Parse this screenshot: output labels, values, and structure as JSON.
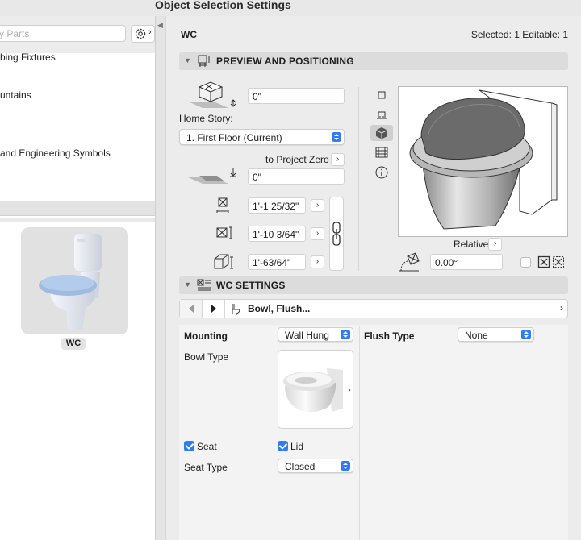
{
  "window": {
    "title": "Object Selection Settings"
  },
  "library": {
    "search_placeholder": "ry Parts",
    "tree_items": [
      "bing Fixtures",
      "untains",
      "and Engineering Symbols"
    ],
    "selected_object_label": "WC"
  },
  "header": {
    "object_name": "WC",
    "selection_info": "Selected: 1 Editable: 1"
  },
  "preview_section": {
    "title": "PREVIEW AND POSITIONING",
    "elevation_value": "0\"",
    "home_story_label": "Home Story:",
    "home_story_value": "1. First Floor (Current)",
    "project_zero_label": "to Project Zero",
    "project_zero_value": "0\"",
    "dimension_1": "1'-1 25/32\"",
    "dimension_2": "1'-10 3/64\"",
    "dimension_3": "1'-63/64\"",
    "relative_label": "Relative",
    "rotation_value": "0.00°"
  },
  "wc_section": {
    "title": "WC SETTINGS",
    "breadcrumb": "Bowl, Flush...",
    "mounting_label": "Mounting",
    "mounting_value": "Wall Hung",
    "flush_type_label": "Flush Type",
    "flush_type_value": "None",
    "bowl_type_label": "Bowl Type",
    "seat_label": "Seat",
    "seat_checked": true,
    "lid_label": "Lid",
    "lid_checked": true,
    "seat_type_label": "Seat Type",
    "seat_type_value": "Closed"
  },
  "colors": {
    "accent": "#2f7cf6",
    "section_bg": "#dcdcdc",
    "panel_bg": "#ececec"
  }
}
